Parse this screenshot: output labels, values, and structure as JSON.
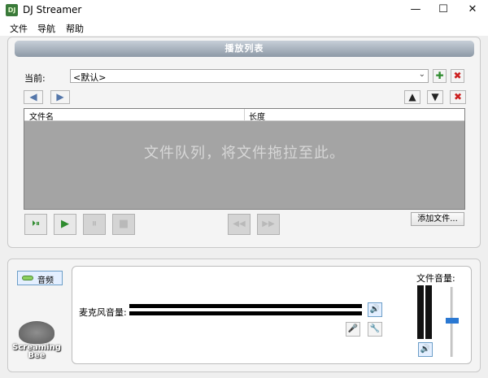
{
  "window": {
    "app_icon": "DJ",
    "title": "DJ Streamer",
    "controls": {
      "minimize": "—",
      "maximize": "☐",
      "close": "✕"
    }
  },
  "menu": {
    "file": "文件",
    "navigate": "导航",
    "help": "帮助"
  },
  "playlist": {
    "header": "播放列表",
    "current_label": "当前:",
    "current_value": "<默认>",
    "dropdown_arrow": "⌄",
    "add_icon": "✚",
    "delete_icon": "✖",
    "prev_icon": "◀",
    "next_icon": "▶",
    "move_up_icon": "▲",
    "move_down_icon": "▼",
    "remove_icon": "✖",
    "columns": {
      "filename": "文件名",
      "length": "长度"
    },
    "empty_message": "文件队列，将文件拖拉至此。",
    "controls": {
      "play_next_icon": "⏵⏸",
      "play_icon": "▶",
      "pause_icon": "⏸",
      "stop_icon": "■",
      "rewind_icon": "◀◀",
      "forward_icon": "▶▶"
    },
    "add_file_label": "添加文件..."
  },
  "audio": {
    "toggle_label": "音频",
    "mic_volume_label": "麦克风音量:",
    "file_volume_label": "文件音量:",
    "speaker_icon": "🔊",
    "mic_icon": "🎤",
    "wrench_icon": "🔧",
    "logo_line1": "Screaming",
    "logo_line2": "Bee"
  },
  "colors": {
    "play_green": "#2e8b2e",
    "delete_red": "#cc1f1f",
    "slider_thumb": "#2a78d2",
    "header_gradient_top": "#c7cfd8",
    "header_gradient_bottom": "#8d99a6"
  }
}
